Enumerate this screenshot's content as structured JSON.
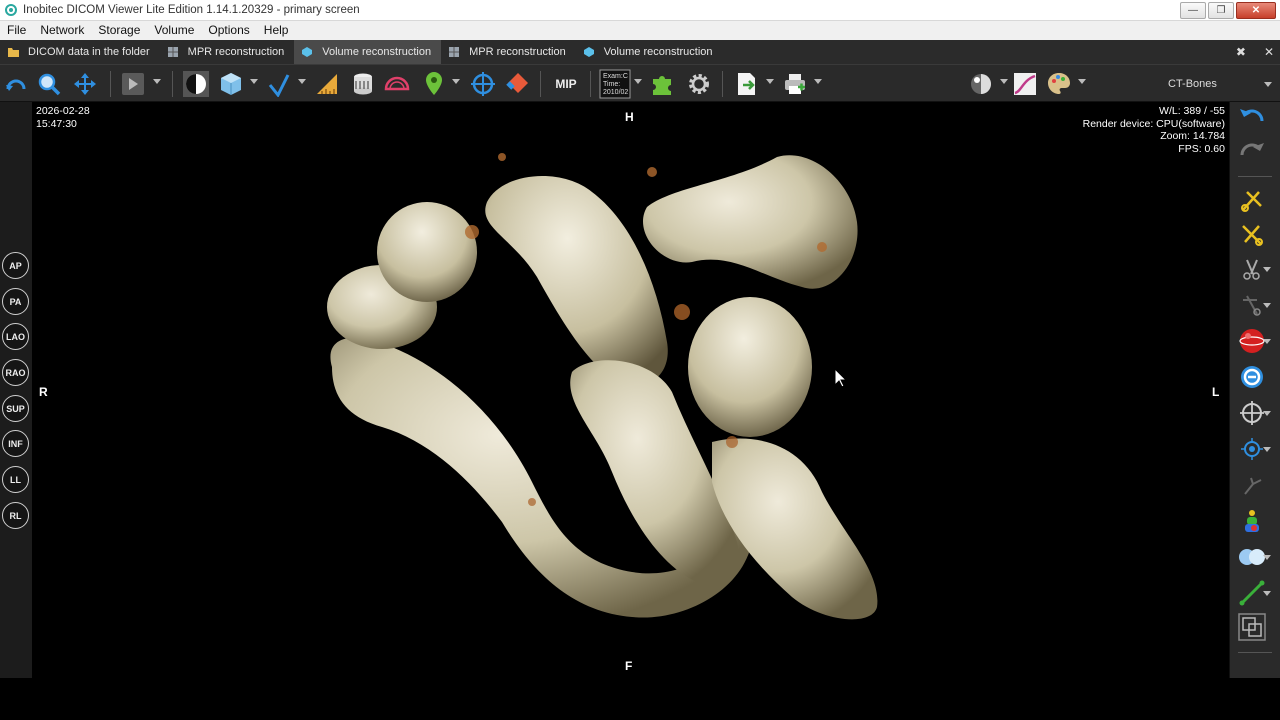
{
  "window": {
    "title": "Inobitec DICOM Viewer Lite Edition 1.14.1.20329 - primary screen",
    "minimize": "—",
    "restore": "❐",
    "close": "✕"
  },
  "menu": [
    "File",
    "Network",
    "Storage",
    "Volume",
    "Options",
    "Help"
  ],
  "tabs": [
    {
      "label": "DICOM data in the folder",
      "icon": "folder-icon",
      "active": false
    },
    {
      "label": "MPR reconstruction",
      "icon": "mpr-icon",
      "active": false
    },
    {
      "label": "Volume reconstruction",
      "icon": "volume-icon",
      "active": true
    },
    {
      "label": "MPR reconstruction",
      "icon": "mpr-icon",
      "active": false
    },
    {
      "label": "Volume reconstruction",
      "icon": "volume-icon",
      "active": false
    }
  ],
  "tab_controls": {
    "pin": "✖",
    "close": "✕"
  },
  "toolbar": {
    "mip_label": "MIP",
    "exam_icon_lines": [
      "Exam:C",
      "Time:",
      "2010/02"
    ],
    "preset": "CT-Bones"
  },
  "viewport": {
    "date": "2026-02-28",
    "time": "15:47:30",
    "wl": "W/L: 389 / -55",
    "render_device": "Render device: CPU(software)",
    "zoom": "Zoom: 14.784",
    "fps": "FPS: 0.60",
    "orientation": {
      "top": "H",
      "bottom": "F",
      "left": "R",
      "right": "L"
    }
  },
  "view_buttons": [
    "AP",
    "PA",
    "LAO",
    "RAO",
    "SUP",
    "INF",
    "LL",
    "RL"
  ],
  "colors": {
    "accent_blue": "#2f8fe0",
    "toolbar_bg": "#2a2a2a",
    "tab_active": "#4a4a4a",
    "bone": "#d8d2b8"
  }
}
